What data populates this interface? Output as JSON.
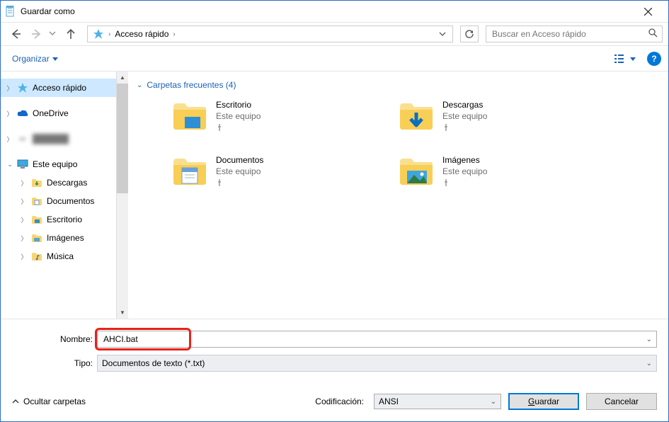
{
  "window": {
    "title": "Guardar como"
  },
  "breadcrumb": {
    "segment1": "Acceso rápido"
  },
  "search": {
    "placeholder": "Buscar en Acceso rápido"
  },
  "cmdbar": {
    "organize": "Organizar"
  },
  "sidebar": {
    "quick_access": "Acceso rápido",
    "onedrive": "OneDrive",
    "this_pc": "Este equipo",
    "downloads": "Descargas",
    "documents": "Documentos",
    "desktop": "Escritorio",
    "pictures": "Imágenes",
    "music": "Música"
  },
  "content": {
    "group_header": "Carpetas frecuentes (4)",
    "items": [
      {
        "name": "Escritorio",
        "loc": "Este equipo"
      },
      {
        "name": "Descargas",
        "loc": "Este equipo"
      },
      {
        "name": "Documentos",
        "loc": "Este equipo"
      },
      {
        "name": "Imágenes",
        "loc": "Este equipo"
      }
    ]
  },
  "form": {
    "name_label": "Nombre:",
    "name_value": "AHCI.bat",
    "type_label": "Tipo:",
    "type_value": "Documentos de texto (*.txt)"
  },
  "footer": {
    "hide_folders": "Ocultar carpetas",
    "encoding_label": "Codificación:",
    "encoding_value": "ANSI",
    "save": "Guardar",
    "cancel": "Cancelar"
  }
}
